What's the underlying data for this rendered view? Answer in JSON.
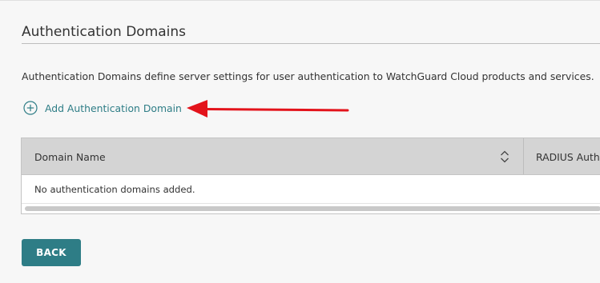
{
  "section": {
    "title": "Authentication Domains",
    "description": "Authentication Domains define server settings for user authentication to WatchGuard Cloud products and services."
  },
  "add_link": {
    "label": "Add Authentication Domain",
    "icon": "plus-circle-icon"
  },
  "annotation": {
    "color": "#e3131b",
    "icon": "red-arrow-icon"
  },
  "table": {
    "columns": [
      {
        "label": "Domain Name",
        "sortable": true,
        "sort_icon": "sort-icon"
      },
      {
        "label": "RADIUS Authe"
      }
    ],
    "empty_message": "No authentication domains added."
  },
  "footer": {
    "back_label": "BACK"
  },
  "colors": {
    "accent": "#2e7d86",
    "header_bg": "#d4d4d4",
    "page_bg": "#f7f7f7"
  }
}
